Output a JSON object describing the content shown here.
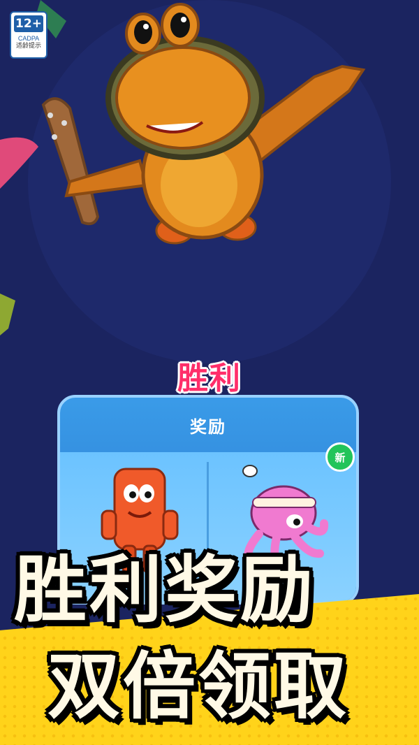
{
  "age_rating": {
    "number": "12+",
    "org": "CADPA",
    "tip": "适龄提示"
  },
  "result": {
    "title": "胜利"
  },
  "reward_panel": {
    "title": "奖励",
    "new_badge": "新"
  },
  "promo": {
    "line1": "胜利奖励",
    "line2": "双倍领取"
  },
  "colors": {
    "background": "#1b2460",
    "accent": "#ff2e6a",
    "panel": "#2a78cf",
    "banner": "#ffd31a",
    "new_badge": "#22c45a"
  }
}
